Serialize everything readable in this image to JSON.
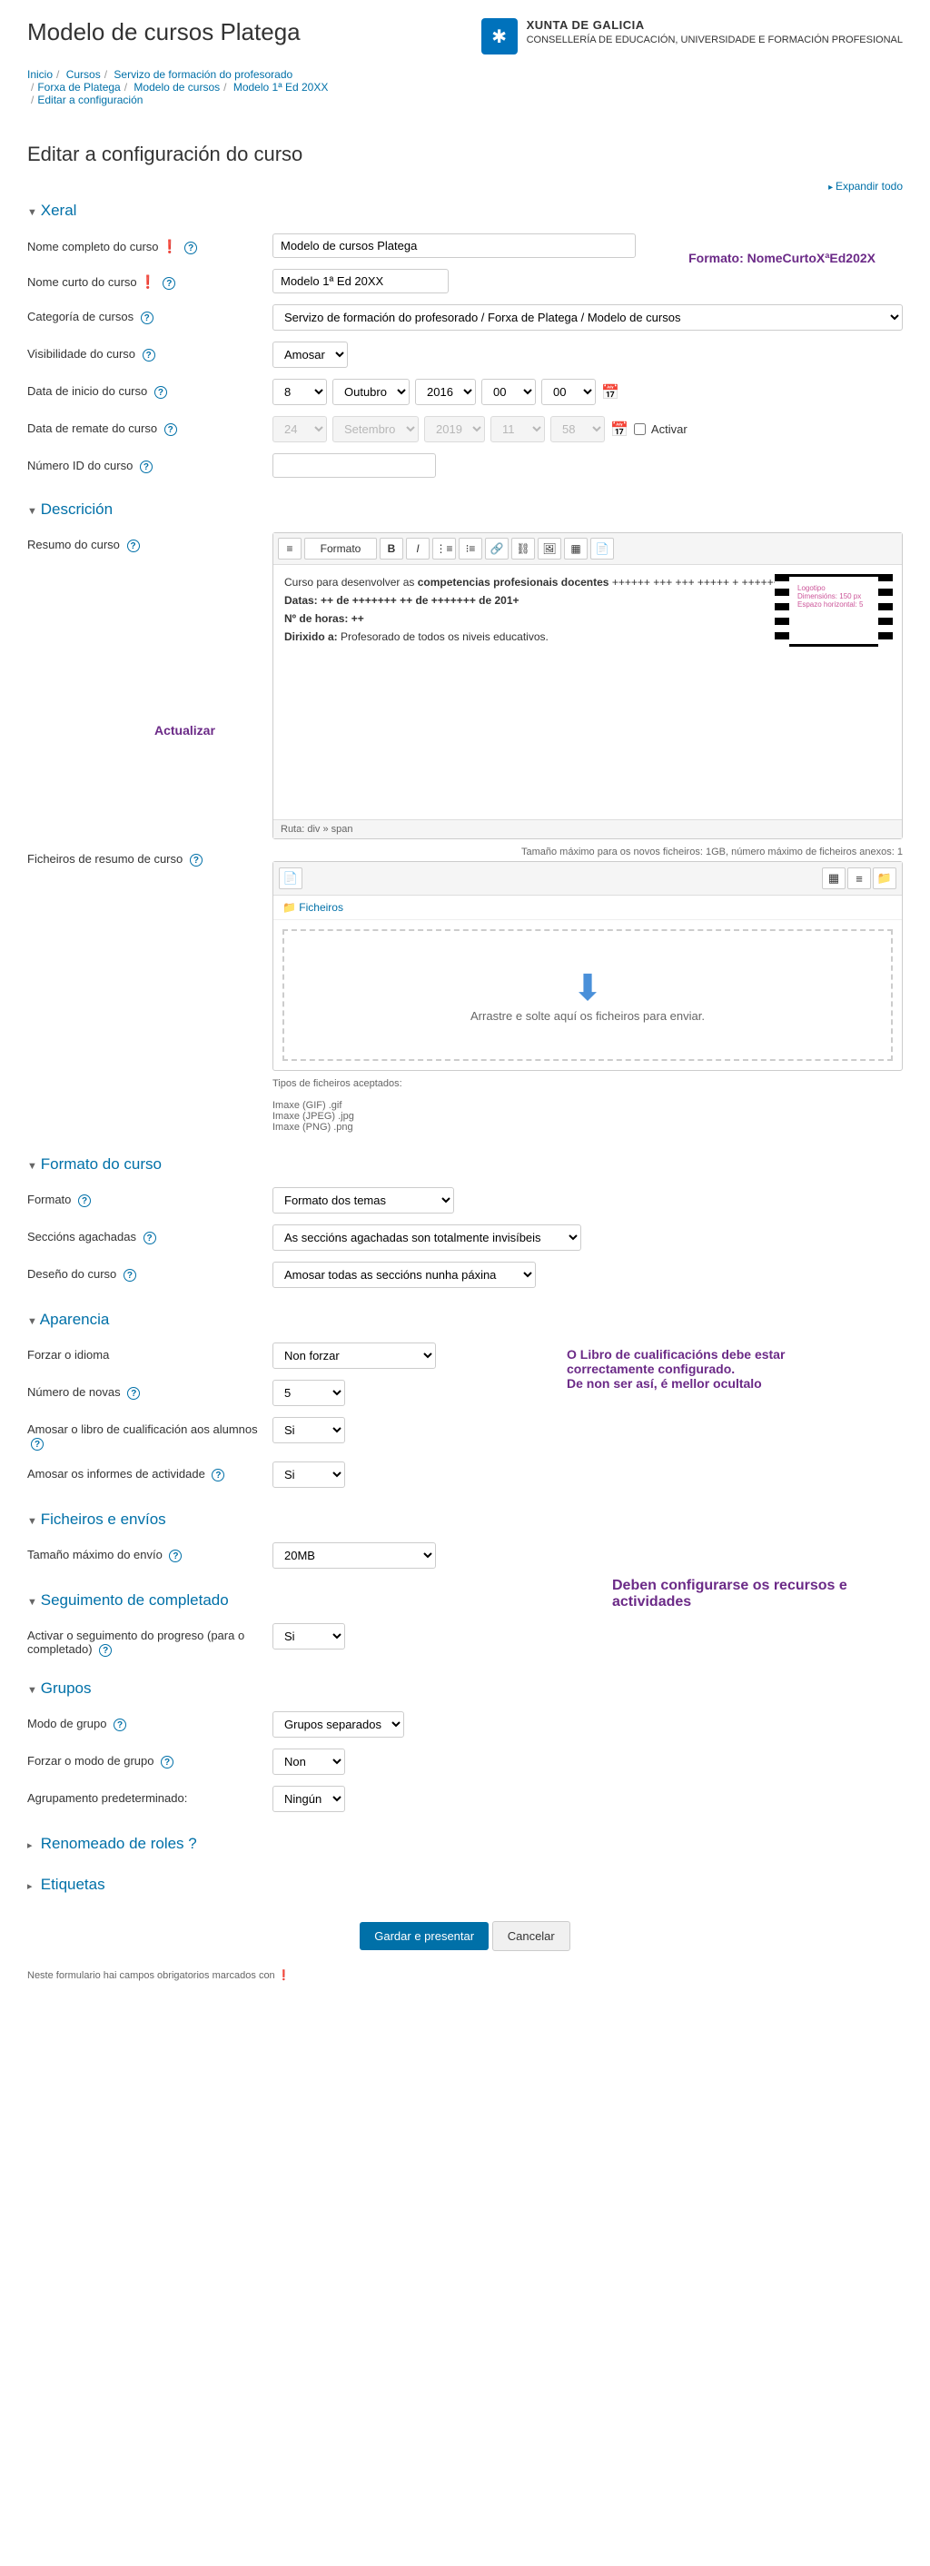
{
  "header": {
    "title": "Modelo de cursos Platega",
    "org_name": "XUNTA DE GALICIA",
    "org_sub": "CONSELLERÍA DE EDUCACIÓN, UNIVERSIDADE E FORMACIÓN PROFESIONAL"
  },
  "breadcrumb": [
    "Inicio",
    "Cursos",
    "Servizo de formación do profesorado",
    "Forxa de Platega",
    "Modelo de cursos",
    "Modelo 1ª Ed 20XX",
    "Editar a configuración"
  ],
  "page_title": "Editar a configuración do curso",
  "expand_all": "Expandir todo",
  "sections": {
    "xeral": "Xeral",
    "descricion": "Descrición",
    "formato": "Formato do curso",
    "aparencia": "Aparencia",
    "ficheiros": "Ficheiros e envíos",
    "seguimento": "Seguimento de completado",
    "grupos": "Grupos",
    "roles": "Renomeado de roles",
    "etiquetas": "Etiquetas"
  },
  "fields": {
    "nome_completo": {
      "label": "Nome completo do curso",
      "value": "Modelo de cursos Platega"
    },
    "nome_curto": {
      "label": "Nome curto do curso",
      "value": "Modelo 1ª Ed 20XX"
    },
    "categoria": {
      "label": "Categoría de cursos",
      "value": "Servizo de formación do profesorado / Forxa de Platega / Modelo de cursos"
    },
    "visibilidade": {
      "label": "Visibilidade do curso",
      "value": "Amosar"
    },
    "data_inicio": {
      "label": "Data de inicio do curso",
      "day": "8",
      "month": "Outubro",
      "year": "2016",
      "hour": "00",
      "min": "00"
    },
    "data_remate": {
      "label": "Data de remate do curso",
      "day": "24",
      "month": "Setembro",
      "year": "2019",
      "hour": "11",
      "min": "58",
      "activate": "Activar"
    },
    "numero_id": {
      "label": "Número ID do curso",
      "value": ""
    },
    "resumo": {
      "label": "Resumo do curso",
      "format_sel": "Formato",
      "content_intro": "Curso para desenvolver as ",
      "content_bold": "competencias profesionais docentes",
      "content_plus": " ++++++ +++ +++ +++++ + ++++++ ++ ++++++ ++ ++ +++",
      "content_datas": "Datas: ++ de +++++++ ++ de +++++++ de 201+",
      "content_horas": "Nº de horas: ++",
      "content_dirixido": "Dirixido a: Profesorado de todos os niveis educativos.",
      "film_logo": "Logotipo",
      "film_dim": "Dimensións: 150 px",
      "film_esp": "Espazo horizontal: 5",
      "path": "Ruta: div » span"
    },
    "ficheiros_resumo": {
      "label": "Ficheiros de resumo de curso",
      "size_info": "Tamaño máximo para os novos ficheiros: 1GB, número máximo de ficheiros anexos: 1",
      "tree": "Ficheiros",
      "drop": "Arrastre e solte aquí os ficheiros para enviar.",
      "types_label": "Tipos de ficheiros aceptados:",
      "type1": "Imaxe (GIF) .gif",
      "type2": "Imaxe (JPEG) .jpg",
      "type3": "Imaxe (PNG) .png"
    },
    "formato": {
      "label": "Formato",
      "value": "Formato dos temas"
    },
    "seccions_agachadas": {
      "label": "Seccións agachadas",
      "value": "As seccións agachadas son totalmente invisíbeis"
    },
    "deseno": {
      "label": "Deseño do curso",
      "value": "Amosar todas as seccións nunha páxina"
    },
    "forzar_idioma": {
      "label": "Forzar o idioma",
      "value": "Non forzar"
    },
    "num_novas": {
      "label": "Número de novas",
      "value": "5"
    },
    "amosar_libro": {
      "label": "Amosar o libro de cualificación aos alumnos",
      "value": "Si"
    },
    "amosar_informes": {
      "label": "Amosar os informes de actividade",
      "value": "Si"
    },
    "tamano_max": {
      "label": "Tamaño máximo do envío",
      "value": "20MB"
    },
    "activar_seguimento": {
      "label": "Activar o seguimento do progreso (para o completado)",
      "value": "Si"
    },
    "modo_grupo": {
      "label": "Modo de grupo",
      "value": "Grupos separados"
    },
    "forzar_grupo": {
      "label": "Forzar o modo de grupo",
      "value": "Non"
    },
    "agrupamento": {
      "label": "Agrupamento predeterminado:",
      "value": "Ningún"
    }
  },
  "annotations": {
    "formato_nome": "Formato: NomeCurtoXªEd202X",
    "actualizar": "Actualizar",
    "libro_cualif": "O Libro de cualificacións debe estar correctamente configurado.",
    "libro_cualif2": "De non ser así, é mellor ocultalo",
    "configurar_recursos": "Deben configurarse os recursos e actividades"
  },
  "actions": {
    "save": "Gardar e presentar",
    "cancel": "Cancelar"
  },
  "footer": "Neste formulario hai campos obrigatorios marcados con"
}
